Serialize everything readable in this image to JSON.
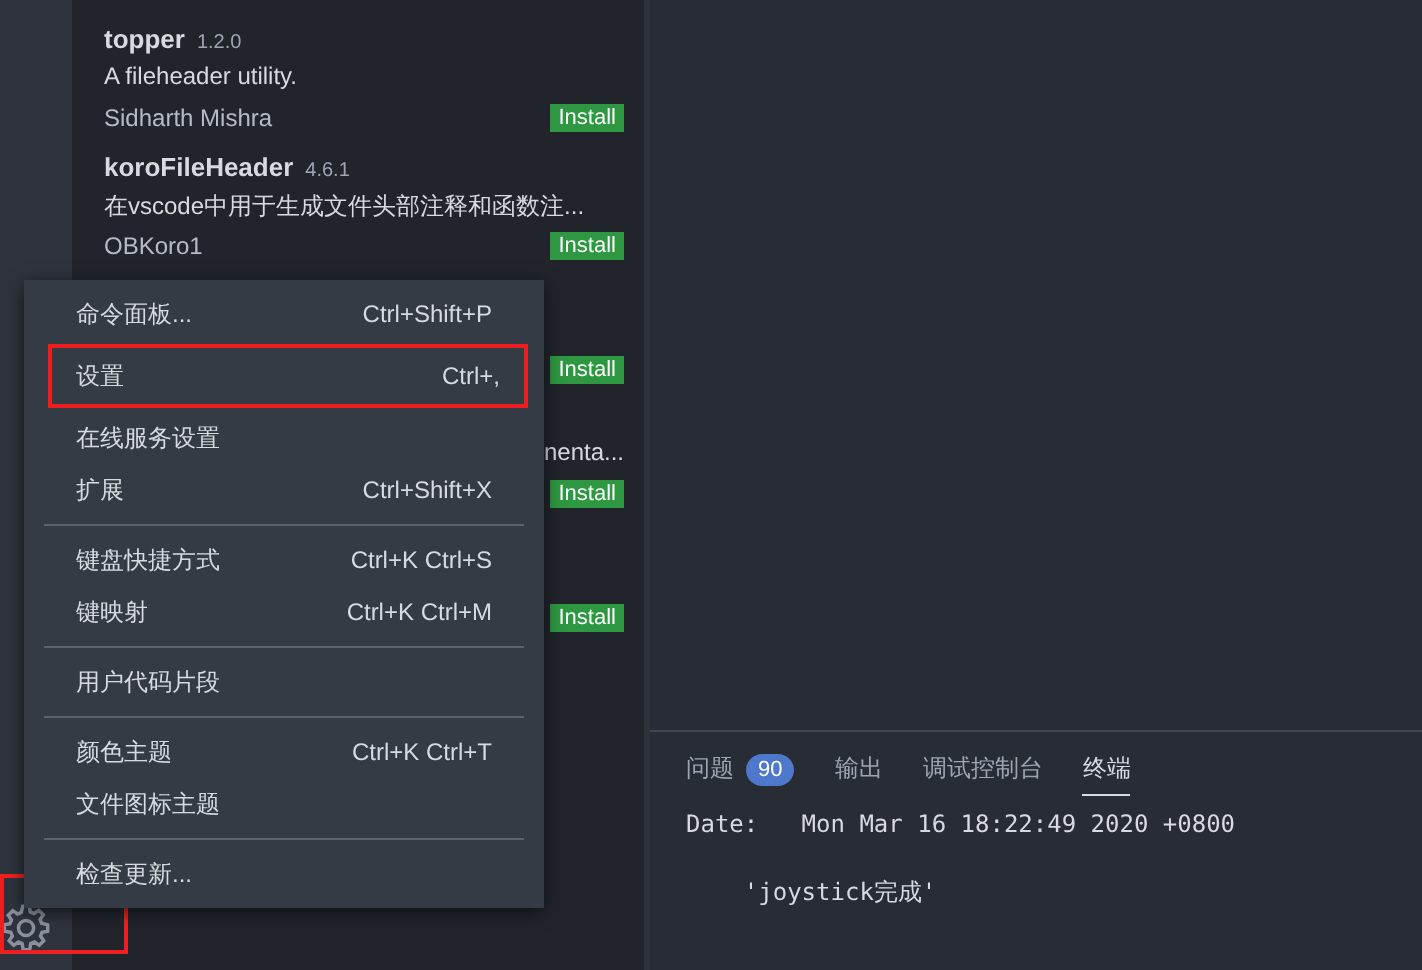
{
  "extensions": [
    {
      "name": "topper",
      "version": "1.2.0",
      "description": "A fileheader utility.",
      "author": "Sidharth Mishra",
      "action": "Install"
    },
    {
      "name": "koroFileHeader",
      "version": "4.6.1",
      "description": "在vscode中用于生成文件头部注释和函数注...",
      "author": "OBKoro1",
      "action": "Install"
    },
    {
      "action": "Install"
    },
    {
      "description": "nenta...",
      "action": "Install"
    },
    {
      "action": "Install"
    }
  ],
  "menu": {
    "groups": [
      [
        {
          "label": "命令面板...",
          "shortcut": "Ctrl+Shift+P",
          "highlighted": false
        },
        {
          "label": "设置",
          "shortcut": "Ctrl+,",
          "highlighted": true
        },
        {
          "label": "在线服务设置",
          "highlighted": false
        },
        {
          "label": "扩展",
          "shortcut": "Ctrl+Shift+X",
          "highlighted": false
        }
      ],
      [
        {
          "label": "键盘快捷方式",
          "shortcut": "Ctrl+K Ctrl+S",
          "highlighted": false
        },
        {
          "label": "键映射",
          "shortcut": "Ctrl+K Ctrl+M",
          "highlighted": false
        }
      ],
      [
        {
          "label": "用户代码片段",
          "highlighted": false
        }
      ],
      [
        {
          "label": "颜色主题",
          "shortcut": "Ctrl+K Ctrl+T",
          "highlighted": false
        },
        {
          "label": "文件图标主题",
          "highlighted": false
        }
      ],
      [
        {
          "label": "检查更新...",
          "highlighted": false
        }
      ]
    ]
  },
  "settings_button": {
    "highlighted": true
  },
  "panel": {
    "tabs": [
      {
        "label": "问题",
        "badge": "90",
        "selected": false
      },
      {
        "label": "输出",
        "selected": false
      },
      {
        "label": "调试控制台",
        "selected": false
      },
      {
        "label": "终端",
        "selected": true
      }
    ],
    "terminal_lines": [
      "Date:   Mon Mar 16 18:22:49 2020 +0800",
      "    'joystick完成'"
    ]
  }
}
